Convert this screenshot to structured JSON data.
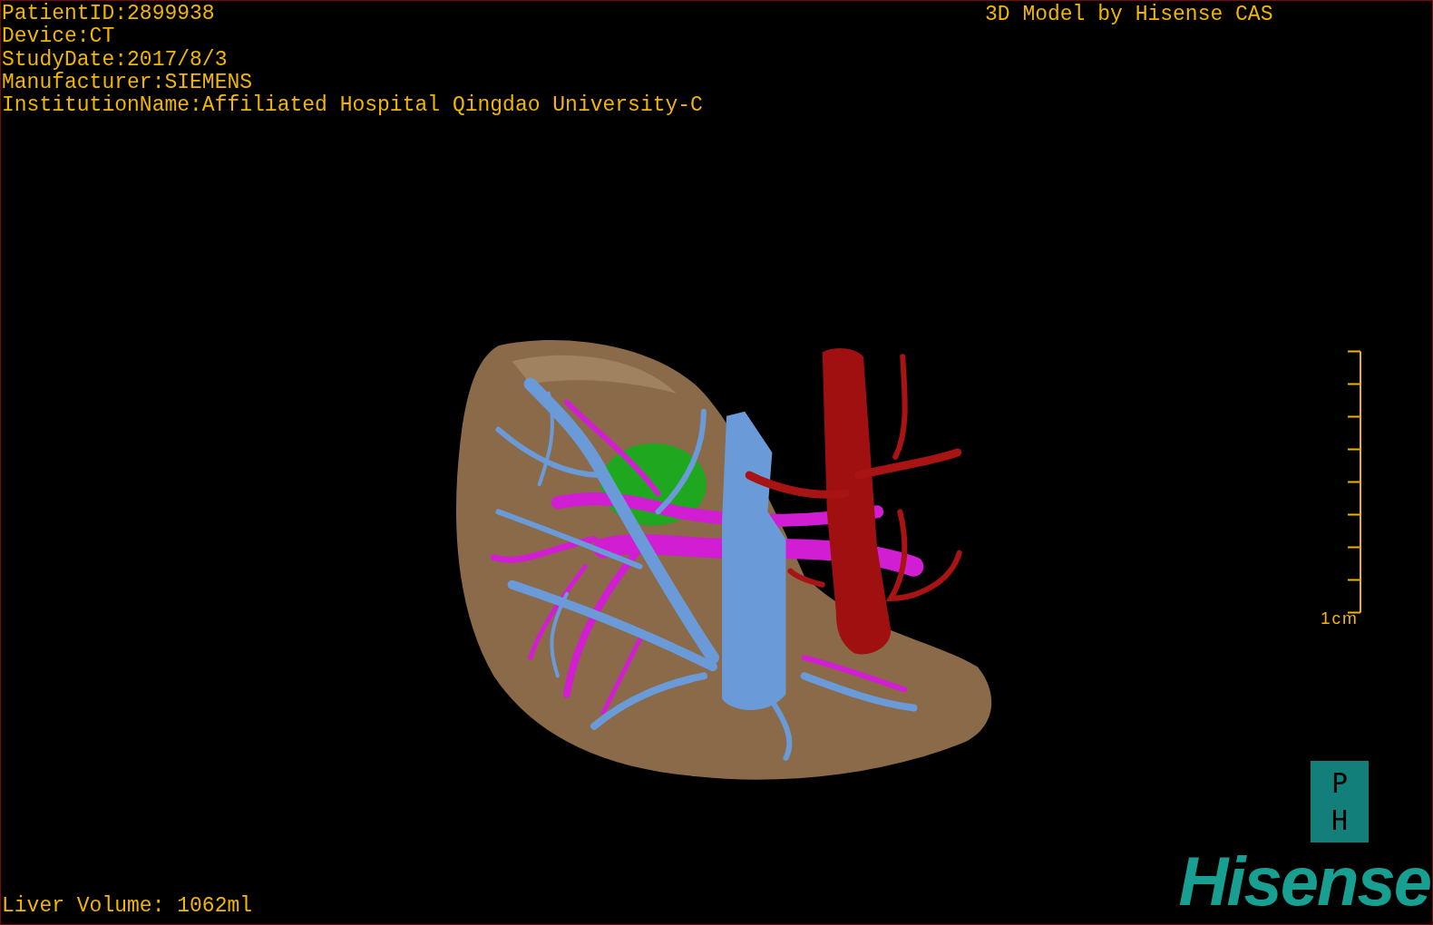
{
  "header": {
    "lines": [
      "PatientID:2899938",
      "Device:CT",
      "StudyDate:2017/8/3",
      "Manufacturer:SIEMENS",
      "InstitutionName:Affiliated Hospital Qingdao University-C"
    ]
  },
  "caption": "3D Model by Hisense CAS",
  "scale_bar": {
    "label": "1cm"
  },
  "footer": {
    "liver_volume": "Liver Volume: 1062ml"
  },
  "logo": {
    "box_letters": [
      "P",
      "H"
    ],
    "wordmark": "Hisense"
  }
}
